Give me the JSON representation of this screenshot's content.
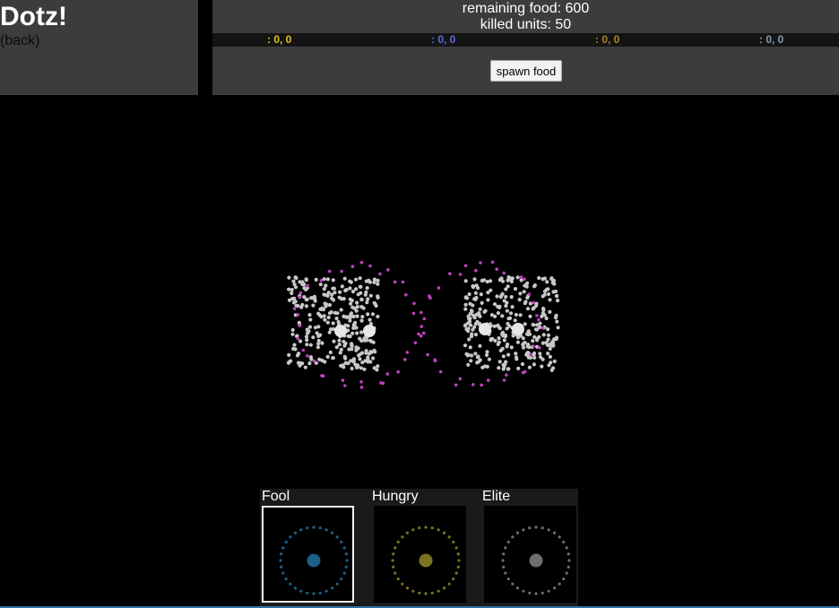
{
  "app": {
    "title": "Dotz!",
    "back_label": "(back)"
  },
  "stats": {
    "remaining_food": "remaining food: 600",
    "killed_units": "killed units: 50"
  },
  "scores": [
    {
      "text": ": 0, 0",
      "color": "#e0c020"
    },
    {
      "text": ": 0, 0",
      "color": "#5c6cdc"
    },
    {
      "text": ": 0, 0",
      "color": "#a8862a"
    },
    {
      "text": ": 0, 0",
      "color": "#8a9aa8"
    }
  ],
  "toolbar": {
    "spawn_food_label": "spawn food"
  },
  "units": [
    {
      "label": "Fool",
      "color": "#1e5f86",
      "selected": true
    },
    {
      "label": "Hungry",
      "color": "#7a7420",
      "selected": false
    },
    {
      "label": "Elite",
      "color": "#6e6e6e",
      "selected": false
    }
  ],
  "colors": {
    "panel": "#3c3c3c",
    "food": "#c8c8c8",
    "drone": "#c040c0",
    "hive": "#e6e6e6"
  }
}
